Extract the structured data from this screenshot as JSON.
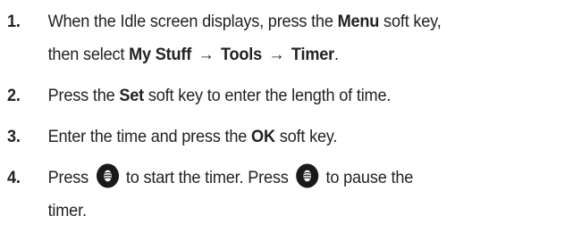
{
  "steps": [
    {
      "number": "1.",
      "line1_pre": "When the Idle screen displays, press the ",
      "line1_bold": "Menu",
      "line1_post": " soft key,",
      "line2_pre": "then select ",
      "path": [
        "My Stuff",
        "Tools",
        "Timer"
      ],
      "arrow": "→",
      "line2_post": "."
    },
    {
      "number": "2.",
      "pre": "Press the ",
      "bold": "Set",
      "post": " soft key to enter the length of time."
    },
    {
      "number": "3.",
      "pre": "Enter the time and press the ",
      "bold": "OK",
      "post": " soft key."
    },
    {
      "number": "4.",
      "pre": "Press",
      "mid": "to start the timer. Press",
      "post": "to pause the",
      "line2": "timer.",
      "icon": "center-select-key-icon"
    }
  ],
  "colors": {
    "text": "#222222",
    "icon_fill": "#1a1a1a"
  }
}
